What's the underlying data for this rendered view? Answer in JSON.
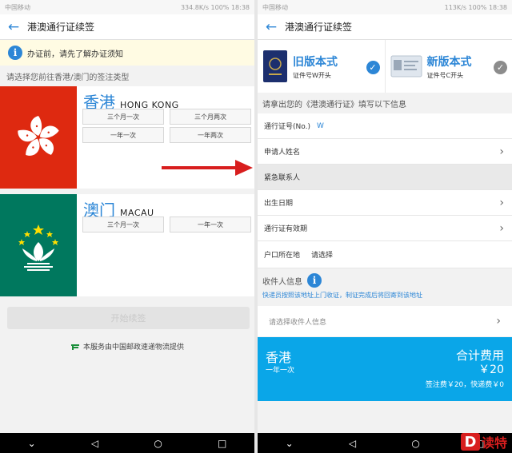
{
  "left": {
    "status": {
      "carrier": "中国移动",
      "right": "334.8K/s  100%  18:38"
    },
    "title": "港澳通行证续签",
    "notice": "办证前，请先了解办证须知",
    "prompt": "请选择您前往香港/澳门的签注类型",
    "hk": {
      "zh": "香港",
      "en": "HONG KONG",
      "options": [
        "三个月一次",
        "三个月两次",
        "一年一次",
        "一年两次"
      ]
    },
    "macau": {
      "zh": "澳门",
      "en": "MACAU",
      "options": [
        "三个月一次",
        "一年一次"
      ]
    },
    "start_btn": "开始续签",
    "service": "本服务由中国邮政速递物流提供"
  },
  "right": {
    "status": {
      "carrier": "中国移动",
      "right": "113K/s  100%  18:38"
    },
    "title": "港澳通行证续签",
    "versions": [
      {
        "title": "旧版本式",
        "sub": "证件号W开头",
        "checked": true
      },
      {
        "title": "新版本式",
        "sub": "证件号C开头",
        "checked": false
      }
    ],
    "section": "请拿出您的《港澳通行证》填写以下信息",
    "rows": {
      "permit_no": "通行证号(No.)",
      "permit_no_value": "W",
      "applicant": "申请人姓名",
      "emergency": "紧急联系人",
      "birth": "出生日期",
      "expiry": "通行证有效期",
      "hukou": "户口所在地",
      "hukou_value": "请选择"
    },
    "recipient": {
      "title": "收件人信息",
      "note": "快递员按照该地址上门收证，制证完成后将回寄到该地址",
      "select": "请选择收件人信息"
    },
    "total": {
      "city": "香港",
      "freq": "一年一次",
      "label": "合计费用",
      "amount": "￥20",
      "detail": "签注费￥20，快递费￥0"
    },
    "watermark": {
      "letter": "D",
      "text": "读特"
    }
  },
  "colors": {
    "accent": "#2c86d6",
    "hk_red": "#de2910",
    "macau_green": "#00785e",
    "total_bg": "#0aa6e8",
    "arrow": "#d81e1e"
  }
}
